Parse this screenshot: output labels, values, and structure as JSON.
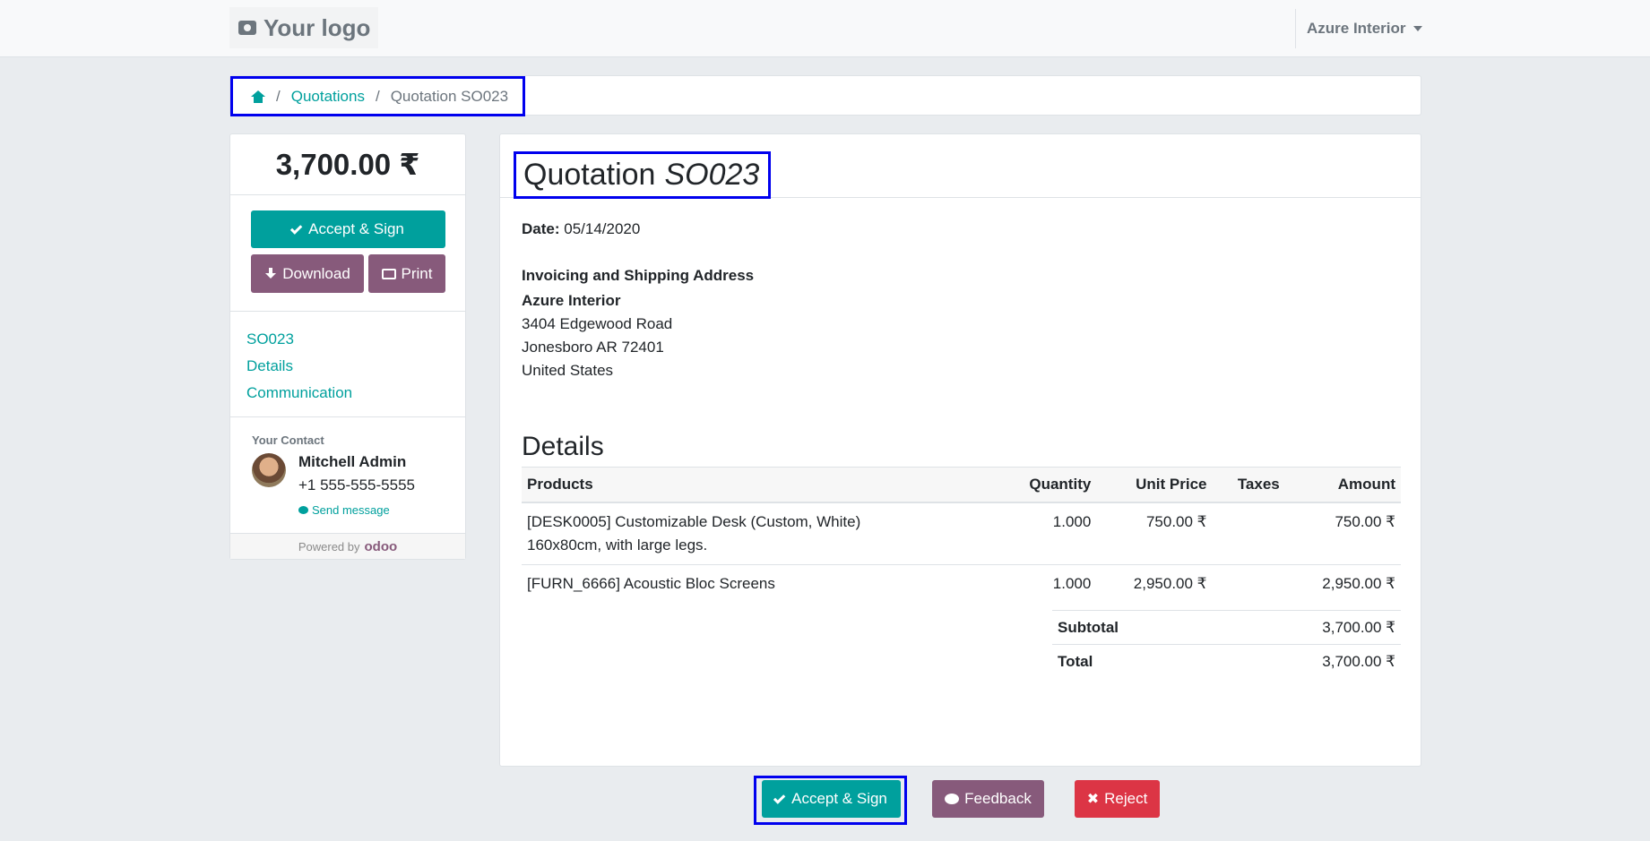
{
  "header": {
    "logo_text": "Your logo",
    "user_menu": "Azure Interior"
  },
  "breadcrumb": {
    "link": "Quotations",
    "active": "Quotation SO023"
  },
  "sidebar": {
    "amount": "3,700.00 ₹",
    "accept_label": "Accept & Sign",
    "download_label": "Download",
    "print_label": "Print",
    "nav": [
      "SO023",
      "Details",
      "Communication"
    ],
    "contact": {
      "label": "Your Contact",
      "name": "Mitchell Admin",
      "phone": "+1 555-555-5555",
      "send_message": "Send message"
    },
    "powered_by": "Powered by",
    "powered_brand": "odoo"
  },
  "document": {
    "title_prefix": "Quotation",
    "title_number": "SO023",
    "date_label": "Date:",
    "date_value": "05/14/2020",
    "address_heading": "Invoicing and Shipping Address",
    "address_name": "Azure Interior",
    "address_lines": [
      "3404 Edgewood Road",
      "Jonesboro AR 72401",
      "United States"
    ],
    "details_title": "Details",
    "columns": [
      "Products",
      "Quantity",
      "Unit Price",
      "Taxes",
      "Amount"
    ],
    "rows": [
      {
        "product_line1": "[DESK0005] Customizable Desk (Custom, White)",
        "product_line2": "160x80cm, with large legs.",
        "quantity": "1.000",
        "unit_price": "750.00 ₹",
        "taxes": "",
        "amount": "750.00 ₹"
      },
      {
        "product_line1": "[FURN_6666] Acoustic Bloc Screens",
        "product_line2": "",
        "quantity": "1.000",
        "unit_price": "2,950.00 ₹",
        "taxes": "",
        "amount": "2,950.00 ₹"
      }
    ],
    "subtotal_label": "Subtotal",
    "subtotal_value": "3,700.00 ₹",
    "total_label": "Total",
    "total_value": "3,700.00 ₹"
  },
  "footer_actions": {
    "accept_label": "Accept & Sign",
    "feedback_label": "Feedback",
    "reject_label": "Reject"
  },
  "colors": {
    "primary": "#00a09d",
    "secondary": "#875a7b",
    "danger": "#dc3545",
    "highlight": "#0000ee"
  }
}
